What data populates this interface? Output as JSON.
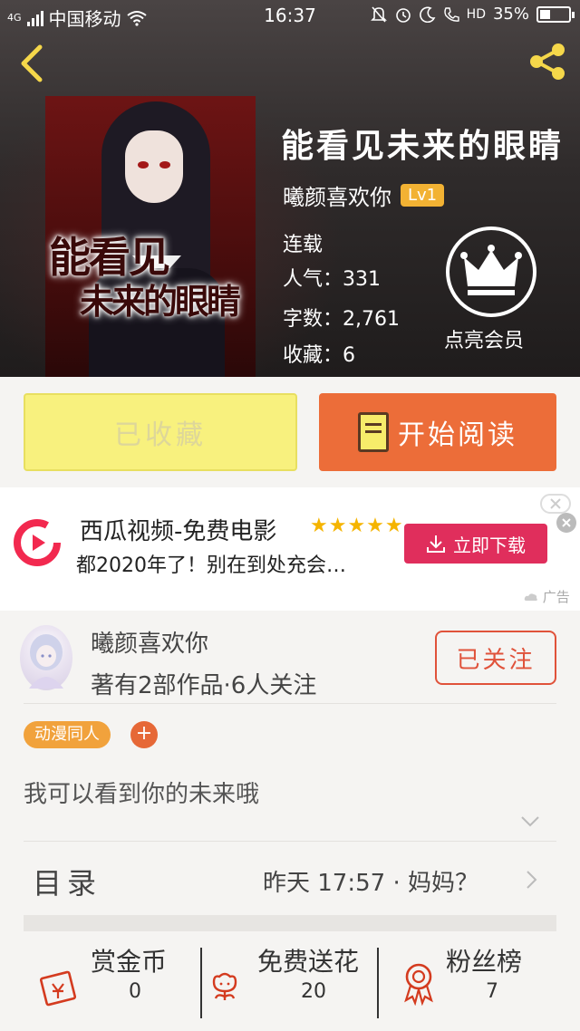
{
  "status_bar": {
    "network": "4G",
    "carrier": "中国移动",
    "time": "16:37",
    "battery": "35%",
    "hd": "HD"
  },
  "book": {
    "title": "能看见未来的眼睛",
    "cover_title_line1": "能看见",
    "cover_title_line2": "未来的眼睛",
    "author": "曦颜喜欢你",
    "author_level": "Lv1",
    "status": "连载",
    "popularity": "人气：331",
    "word_count": "字数：2,761",
    "favorites": "收藏：6",
    "vip_label": "点亮会员"
  },
  "actions": {
    "favorited_label": "已收藏",
    "start_reading_label": "开始阅读"
  },
  "ad": {
    "title": "西瓜视频-免费电影",
    "stars": "★★★★★",
    "description": "都2020年了！别在到处充会…",
    "download_label": "立即下载",
    "ad_tag": "广告"
  },
  "author_card": {
    "name": "曦颜喜欢你",
    "stats": "著有2部作品·6人关注",
    "follow_label": "已关注",
    "tag": "动漫同人",
    "tag_add": "+",
    "description": "我可以看到你的未来哦"
  },
  "toc": {
    "label": "目录",
    "last_update": "昨天 17:57 · 妈妈？"
  },
  "stats": [
    {
      "label": "赏金币",
      "value": "0"
    },
    {
      "label": "免费送花",
      "value": "20"
    },
    {
      "label": "粉丝榜",
      "value": "7"
    }
  ],
  "colors": {
    "accent_orange": "#ec6d39",
    "favorite_yellow": "#f8f17e",
    "level_badge": "#f2b233",
    "ad_button": "#e02e5c",
    "follow_red": "#e0523a"
  }
}
